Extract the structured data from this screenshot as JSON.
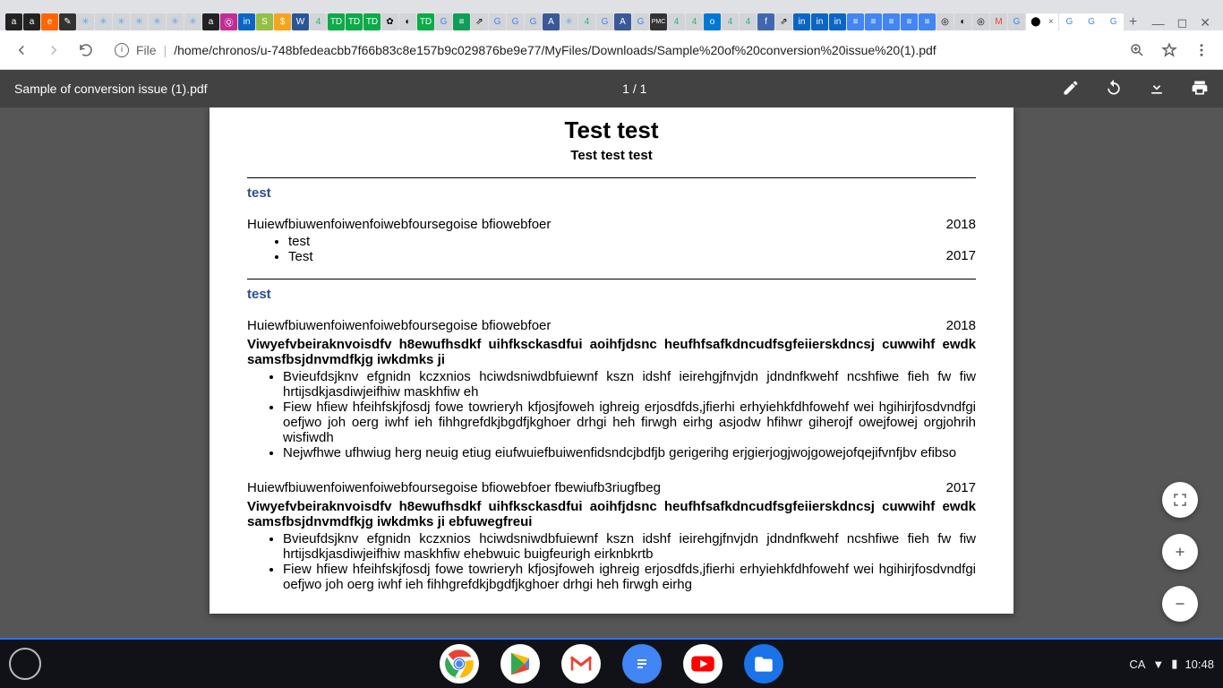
{
  "browser": {
    "tabs_active_title": "G",
    "tabs_plus": "+",
    "url_scheme": "File",
    "url_path": "/home/chronos/u-748bfedeacbb7f66b83c8e157b9c029876be9e77/MyFiles/Downloads/Sample%20of%20conversion%20issue%20(1).pdf"
  },
  "pdf": {
    "title": "Sample of conversion issue (1).pdf",
    "page_indicator": "1 / 1"
  },
  "doc": {
    "title": "Test test",
    "subtitle": "Test test test",
    "section1": {
      "heading": "test",
      "entry1": {
        "title": "Huiewfbiuwenfoiwenfoiwebfoursegoise bfiowebfoer",
        "year1": "2018",
        "bullets": [
          "test",
          "Test"
        ],
        "year2": "2017"
      }
    },
    "section2": {
      "heading": "test",
      "entry1": {
        "title": "Huiewfbiuwenfoiwenfoiwebfoursegoise bfiowebfoer",
        "year": "2018",
        "desc": "Viwyefvbeiraknvoisdfv h8ewufhsdkf uihfksckasdfui aoihfjdsnc heufhfsafkdncudfsgfeiierskdncsj cuwwihf ewdk samsfbsjdnvmdfkjg iwkdmks ji",
        "bullets": [
          "Bvieufdsjknv efgnidn kczxnios hciwdsniwdbfuiewnf kszn idshf ieirehgjfnvjdn jdndnfkwehf ncshfiwe fieh fw fiw hrtijsdkjasdiwjeifhiw maskhfiw eh",
          "Fiew hfiew hfeihfskjfosdj fowe towrieryh kfjosjfoweh ighreig erjosdfds,jfierhi erhyiehkfdhfowehf wei hgihirjfosdvndfgi oefjwo joh oerg iwhf ieh fihhgrefdkjbgdfjkghoer drhgi heh firwgh eirhg asjodw hfihwr giherojf owejfowej orgjohrih wisfiwdh",
          "Nejwfhwe ufhwiug herg neuig etiug eiufwuiefbuiwenfidsndcjbdfjb gerigerihg erjgierjogjwojgowejofqejifvnfjbv efibso"
        ]
      },
      "entry2": {
        "title": "Huiewfbiuwenfoiwenfoiwebfoursegoise bfiowebfoer fbewiufb3riugfbeg",
        "year": "2017",
        "desc": "Viwyefvbeiraknvoisdfv h8ewufhsdkf uihfksckasdfui aoihfjdsnc heufhfsafkdncudfsgfeiierskdncsj cuwwihf ewdk samsfbsjdnvmdfkjg iwkdmks ji ebfuwegfreui",
        "bullets": [
          "Bvieufdsjknv efgnidn kczxnios hciwdsniwdbfuiewnf kszn idshf ieirehgjfnvjdn jdndnfkwehf ncshfiwe fieh fw fiw hrtijsdkjasdiwjeifhiw maskhfiw ehebwuic buigfeurigh eirknbkrtb",
          "Fiew hfiew hfeihfskjfosdj fowe towrieryh kfjosjfoweh ighreig erjosdfds,jfierhi erhyiehkfdhfowehf wei hgihirjfosdvndfgi oefjwo joh oerg iwhf ieh fihhgrefdkjbgdfjkghoer drhgi heh firwgh eirhg"
        ]
      }
    }
  },
  "shelf": {
    "locale": "CA",
    "time": "10:48"
  }
}
